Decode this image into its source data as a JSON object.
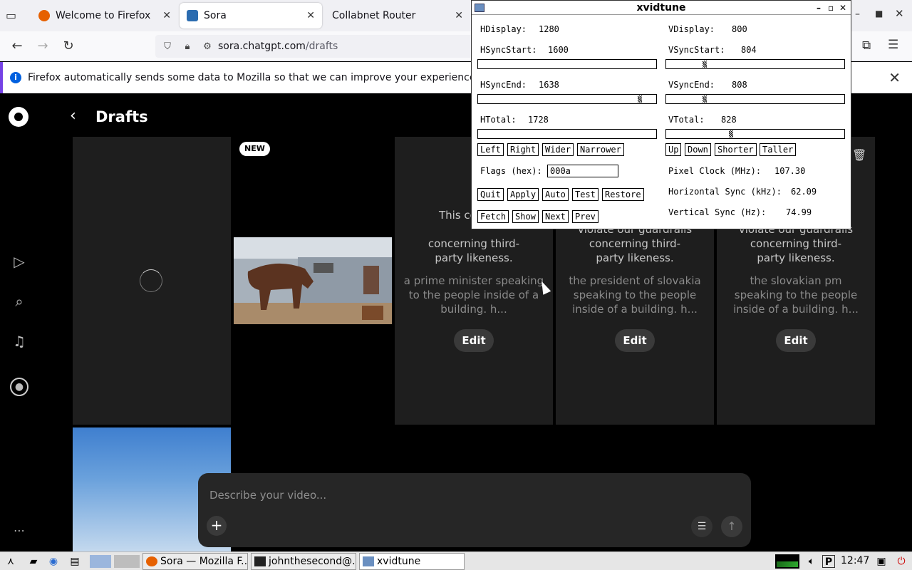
{
  "browser": {
    "tabs": [
      {
        "label": "Welcome to Firefox",
        "close": "✕"
      },
      {
        "label": "Sora",
        "close": "✕"
      },
      {
        "label": "Collabnet Router",
        "close": "✕"
      }
    ],
    "url": {
      "host": "sora.chatgpt.com",
      "path": "/drafts"
    },
    "notification": {
      "message": "Firefox automatically sends some data to Mozilla so that we can improve your experience.",
      "close": "✕"
    }
  },
  "sora": {
    "page_title": "Drafts",
    "new_badge": "NEW",
    "violation": [
      "This content may violate our guardrails concerning third-party likeness.",
      "violate our guardrails concerning third-party likeness.",
      "violate our guardrails concerning third-party likeness."
    ],
    "violation_visible_start": "This cor",
    "prompts": [
      "a prime minister speaking to the people inside of a building. h...",
      "the president of slovakia speaking to the people inside of a building. h...",
      "the slovakian pm speaking to the people inside of a building. h..."
    ],
    "edit_label": "Edit",
    "composer": {
      "placeholder": "Describe your video..."
    }
  },
  "xvidtune": {
    "title": "xvidtune",
    "hdisplay": {
      "label": "HDisplay:",
      "value": "1280"
    },
    "vdisplay": {
      "label": "VDisplay:",
      "value": "800"
    },
    "hsyncstart": {
      "label": "HSyncStart:",
      "value": "1600"
    },
    "vsyncstart": {
      "label": "VSyncStart:",
      "value": "804"
    },
    "hsyncend": {
      "label": "HSyncEnd:",
      "value": "1638"
    },
    "vsyncend": {
      "label": "VSyncEnd:",
      "value": "808"
    },
    "htotal": {
      "label": "HTotal:",
      "value": "1728"
    },
    "vtotal": {
      "label": "VTotal:",
      "value": "828"
    },
    "buttons_h": [
      "Left",
      "Right",
      "Wider",
      "Narrower"
    ],
    "buttons_v": [
      "Up",
      "Down",
      "Shorter",
      "Taller"
    ],
    "flags_label": "Flags (hex):",
    "flags_value": "000a",
    "pixel_clock": {
      "label": "Pixel Clock (MHz):",
      "value": "107.30"
    },
    "hsync": {
      "label": "Horizontal Sync (kHz):",
      "value": "62.09"
    },
    "vsync": {
      "label": "Vertical Sync (Hz):",
      "value": "74.99"
    },
    "buttons_row1": [
      "Quit",
      "Apply",
      "Auto",
      "Test",
      "Restore"
    ],
    "buttons_row2": [
      "Fetch",
      "Show",
      "Next",
      "Prev"
    ]
  },
  "taskbar": {
    "tasks": [
      "Sora — Mozilla F...",
      "johnthesecond@...",
      "xvidtune"
    ],
    "clock": "12:47"
  }
}
